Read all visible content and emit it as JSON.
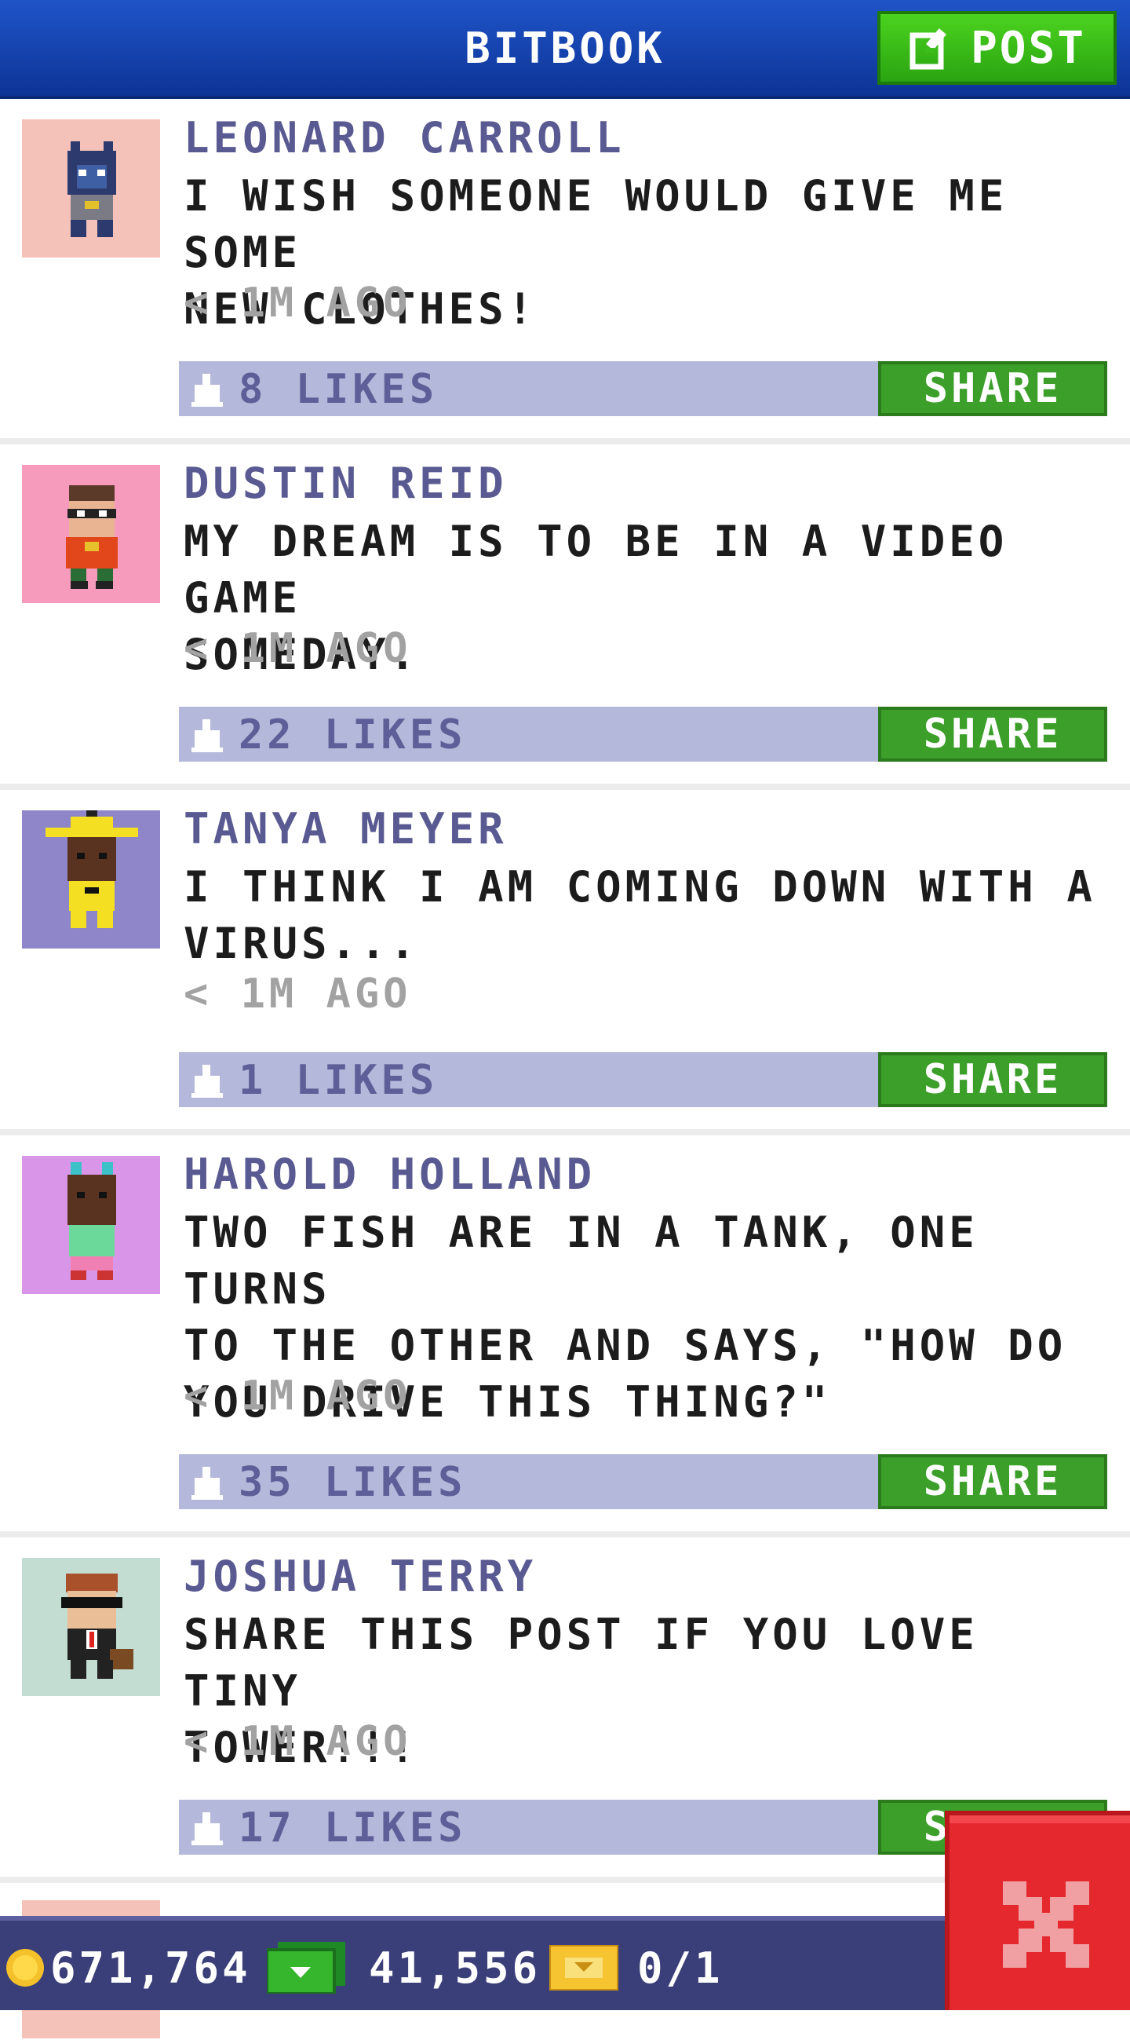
{
  "header": {
    "title": "BITBOOK",
    "post_label": "POST"
  },
  "posts": [
    {
      "name": "LEONARD CARROLL",
      "lines": [
        "I WISH SOMEONE WOULD GIVE ME SOME",
        "NEW CLOTHES!"
      ],
      "time": "< 1M AGO",
      "likes": "8 LIKES",
      "share": "SHARE",
      "avatar_bg": "#f4c2b8"
    },
    {
      "name": "DUSTIN REID",
      "lines": [
        "MY DREAM IS TO BE IN A VIDEO GAME",
        "SOMEDAY."
      ],
      "time": "< 1M AGO",
      "likes": "22 LIKES",
      "share": "SHARE",
      "avatar_bg": "#f79bbd"
    },
    {
      "name": "TANYA MEYER",
      "lines": [
        "I THINK I AM COMING DOWN WITH A",
        "VIRUS..."
      ],
      "time": "< 1M AGO",
      "likes": "1 LIKES",
      "share": "SHARE",
      "avatar_bg": "#8e86c8"
    },
    {
      "name": "HAROLD HOLLAND",
      "lines": [
        "TWO FISH ARE IN A TANK, ONE TURNS",
        "TO THE OTHER AND SAYS, \"HOW DO",
        "YOU DRIVE THIS THING?\""
      ],
      "time": "< 1M AGO",
      "likes": "35 LIKES",
      "share": "SHARE",
      "avatar_bg": "#d996e8"
    },
    {
      "name": "JOSHUA TERRY",
      "lines": [
        "SHARE THIS POST IF YOU LOVE TINY",
        "TOWER!!!"
      ],
      "time": "< 1M AGO",
      "likes": "17 LIKES",
      "share": "SHARE",
      "avatar_bg": "#c4ddd2"
    }
  ],
  "footer": {
    "coins": "671,764",
    "bux": "41,556",
    "tickets": "0/1"
  },
  "colors": {
    "header": "#1a4fc4",
    "post_button": "#3bbd1b",
    "likes_bar": "#b4b8da",
    "share_button": "#3c9f2a",
    "footer": "#3b3f79",
    "close_button": "#e4282e"
  },
  "icons": [
    "edit-icon",
    "like-icon",
    "coin-icon",
    "bux-icon",
    "ticket-icon",
    "close-icon"
  ]
}
